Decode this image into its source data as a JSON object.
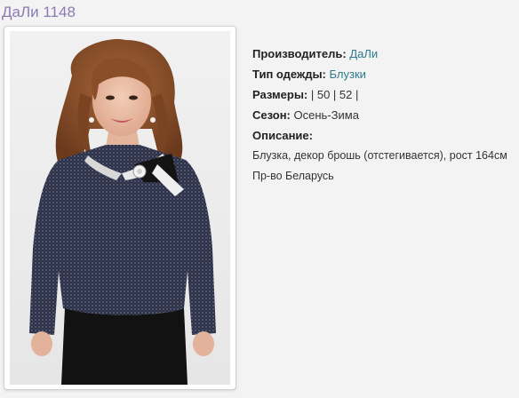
{
  "product": {
    "title": "ДаЛи 1148"
  },
  "details": {
    "manufacturer_label": "Производитель:",
    "manufacturer_value": "ДаЛи",
    "clothing_type_label": "Тип одежды:",
    "clothing_type_value": "Блузки",
    "sizes_label": "Размеры:",
    "sizes_value": "| 50 | 52 |",
    "season_label": "Сезон:",
    "season_value": "Осень-Зима",
    "description_label": "Описание:",
    "description_line1": "Блузка, декор брошь (отстегивается), рост 164см",
    "description_line2": "Пр-во Беларусь"
  },
  "colors": {
    "title": "#8a7bb2",
    "link": "#2e7b8c",
    "blouse": "#2a2f45",
    "trousers": "#111111"
  },
  "image": {
    "icon": "model-wearing-blouse-photo"
  }
}
